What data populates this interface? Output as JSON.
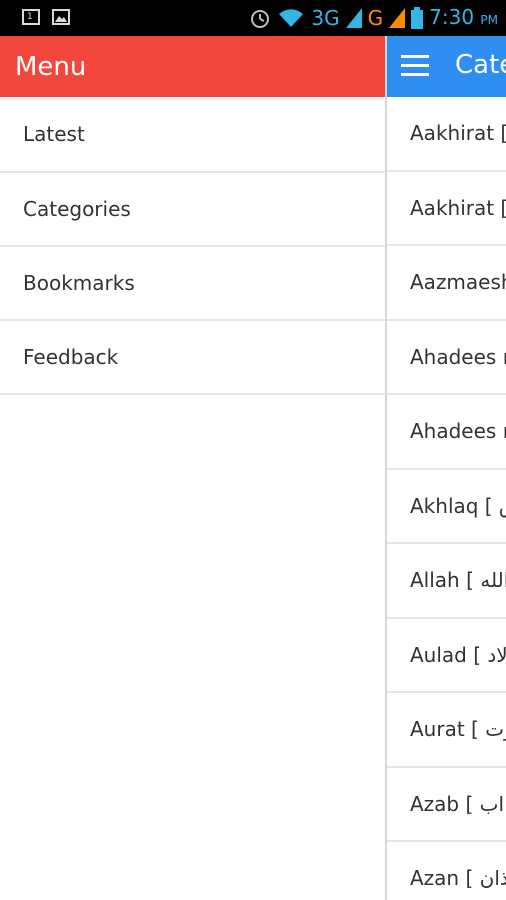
{
  "status_bar": {
    "left_icons": [
      "notification-1-icon",
      "image-icon"
    ],
    "box_number": "1",
    "network_3g": "3G",
    "network_g": "G",
    "time": "7:30",
    "ampm": "PM"
  },
  "drawer": {
    "title": "Menu",
    "items": [
      {
        "label": "Latest"
      },
      {
        "label": "Categories"
      },
      {
        "label": "Bookmarks"
      },
      {
        "label": "Feedback"
      }
    ]
  },
  "main": {
    "title": "Categories",
    "items": [
      {
        "label": "Aakhirat ["
      },
      {
        "label": "Aakhirat ["
      },
      {
        "label": "Aazmaesh"
      },
      {
        "label": "Ahadees n"
      },
      {
        "label": "Ahadees n"
      },
      {
        "label": "Akhlaq [ ق"
      },
      {
        "label": "Allah [ الله"
      },
      {
        "label": "Aulad [ لاد"
      },
      {
        "label": "Aurat [ رت"
      },
      {
        "label": "Azab [ اب"
      },
      {
        "label": "Azan [ ذان"
      }
    ]
  },
  "colors": {
    "drawer_header": "#f2473c",
    "app_bar": "#2f8ef0",
    "status_accent": "#33b5e5",
    "signal_g": "#ff8a00"
  }
}
